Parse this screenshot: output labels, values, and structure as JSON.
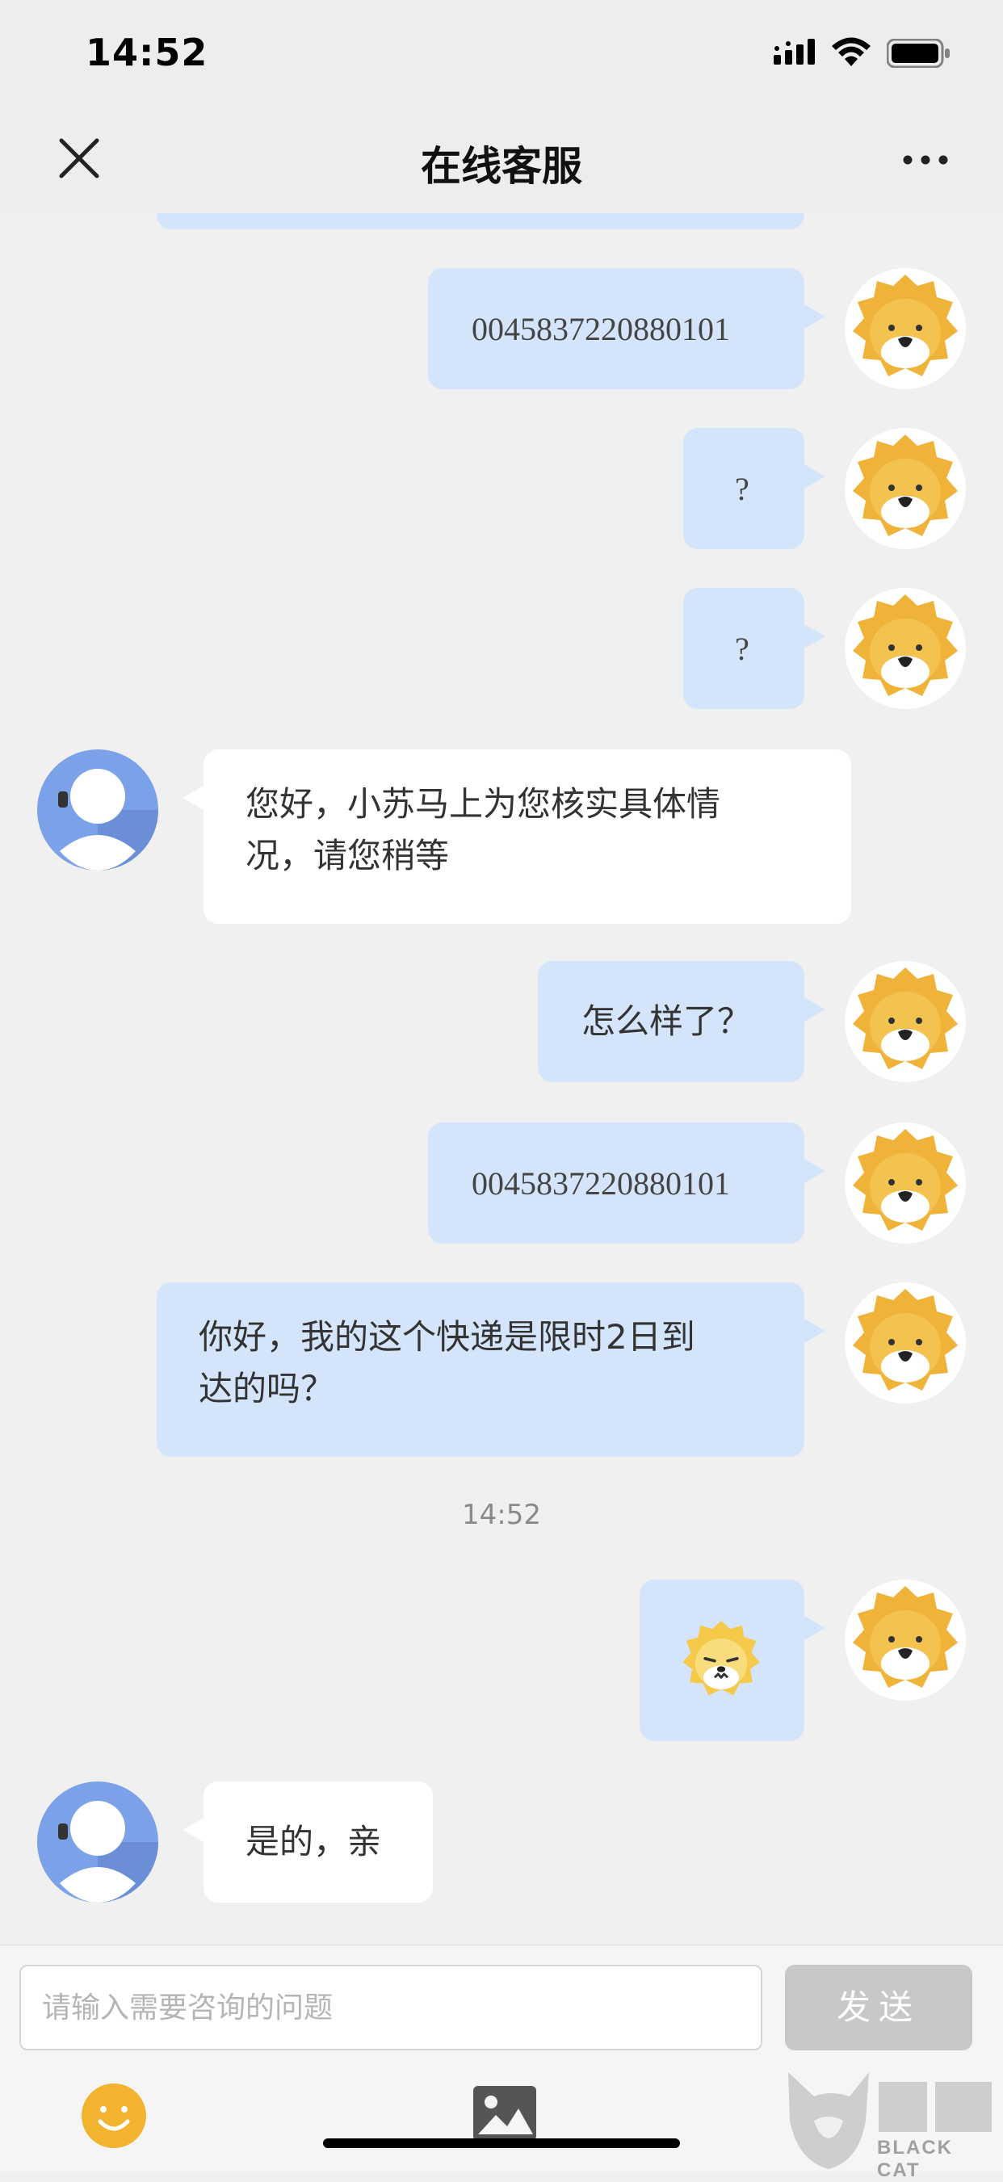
{
  "status_bar": {
    "time": "14:52"
  },
  "header": {
    "title": "在线客服"
  },
  "messages": [
    {
      "text": "0045837220880101",
      "sender": "user"
    },
    {
      "text": "?",
      "sender": "user"
    },
    {
      "text": "?",
      "sender": "user"
    },
    {
      "text_line1": "您好，小苏马上为您核实具体情",
      "text_line2": "况，请您稍等",
      "sender": "agent"
    },
    {
      "text": "怎么样了？",
      "sender": "user"
    },
    {
      "text": "0045837220880101",
      "sender": "user"
    },
    {
      "text_line1": "你好，我的这个快递是限时2日到",
      "text_line2": "达的吗？",
      "sender": "user"
    },
    {
      "timestamp": "14:52"
    },
    {
      "sticker": "lion-sticker-icon",
      "sender": "user"
    },
    {
      "text": "是的，亲",
      "sender": "agent"
    }
  ],
  "input": {
    "placeholder": "请输入需要咨询的问题",
    "send_label": "发送"
  },
  "watermark": {
    "text": "BLACK CAT"
  },
  "colors": {
    "user_bubble": "#d4e4fb",
    "agent_bubble": "#ffffff",
    "lion": "#f0b33a",
    "agent_avatar": "#7ba1e8",
    "emoji": "#f2b32e"
  }
}
